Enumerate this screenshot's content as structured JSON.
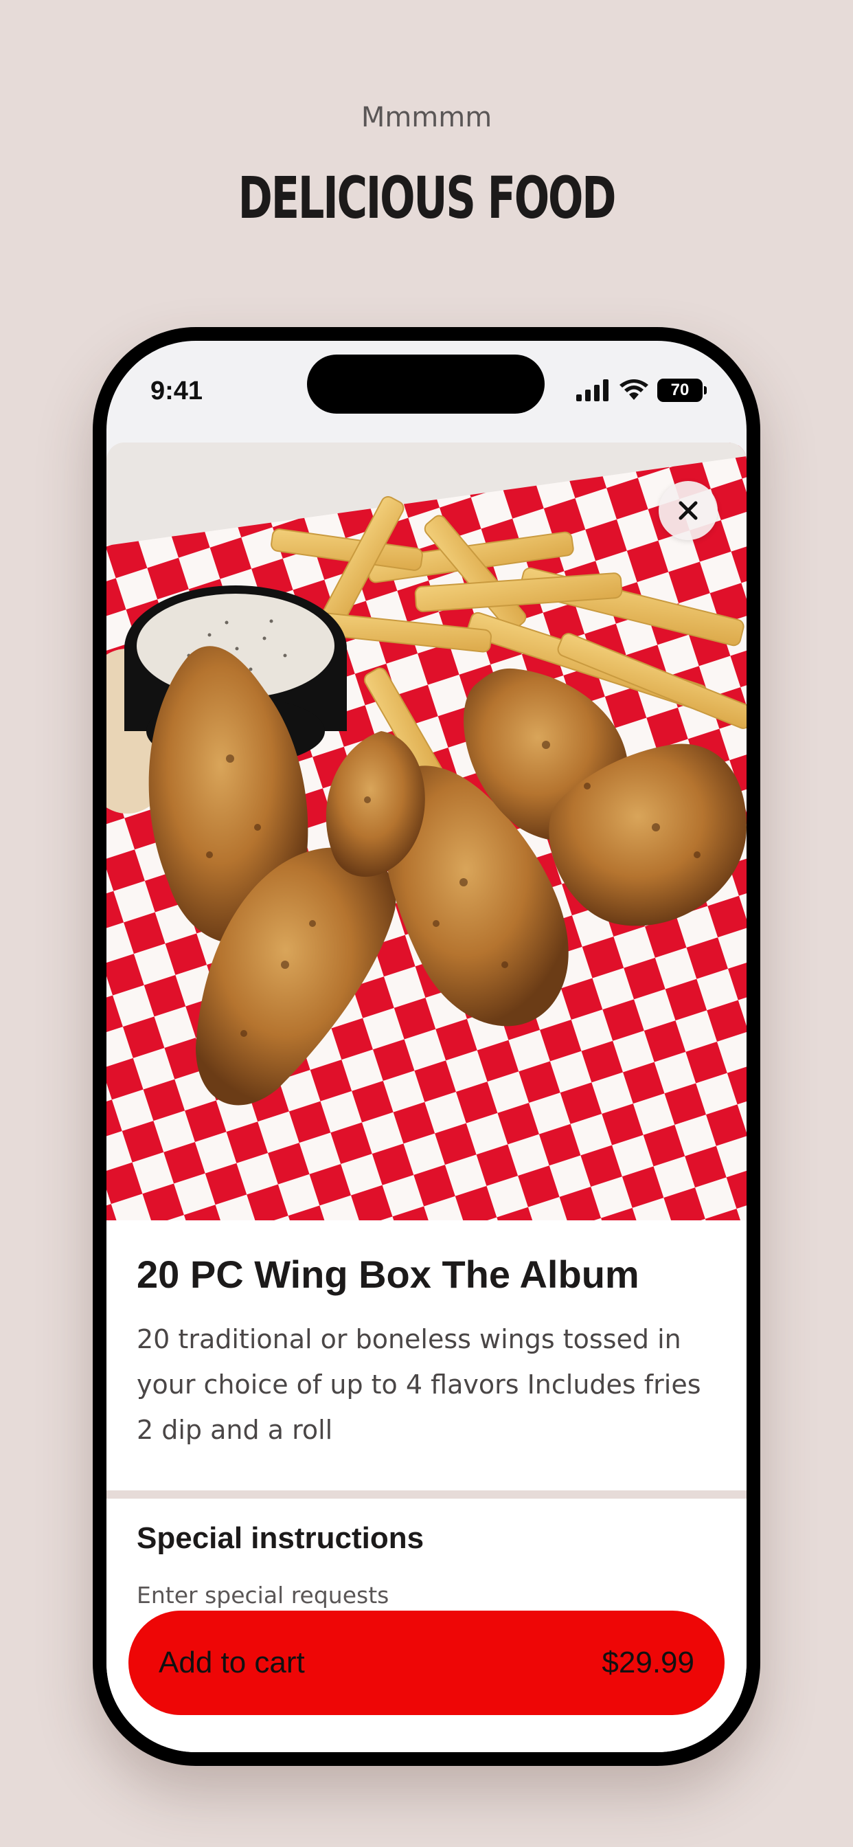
{
  "hero": {
    "tagline": "Mmmmm",
    "headline": "DELICIOUS FOOD"
  },
  "status_bar": {
    "time": "9:41",
    "battery": "70",
    "icons": [
      "cellular-signal-icon",
      "wifi-icon",
      "battery-icon"
    ]
  },
  "product": {
    "image": "chicken-wings-with-fries-and-ranch-photo",
    "title": "20 PC Wing Box The Album",
    "description": "20 traditional or boneless wings tossed in your choice of up to 4 flavors Includes fries 2 dip and a roll"
  },
  "special_instructions": {
    "title": "Special instructions",
    "placeholder": "Enter special requests"
  },
  "cart": {
    "label": "Add to cart",
    "price": "$29.99"
  },
  "colors": {
    "background": "#e6dbd8",
    "accent": "#ee0606",
    "text": "#1c1a1a"
  }
}
